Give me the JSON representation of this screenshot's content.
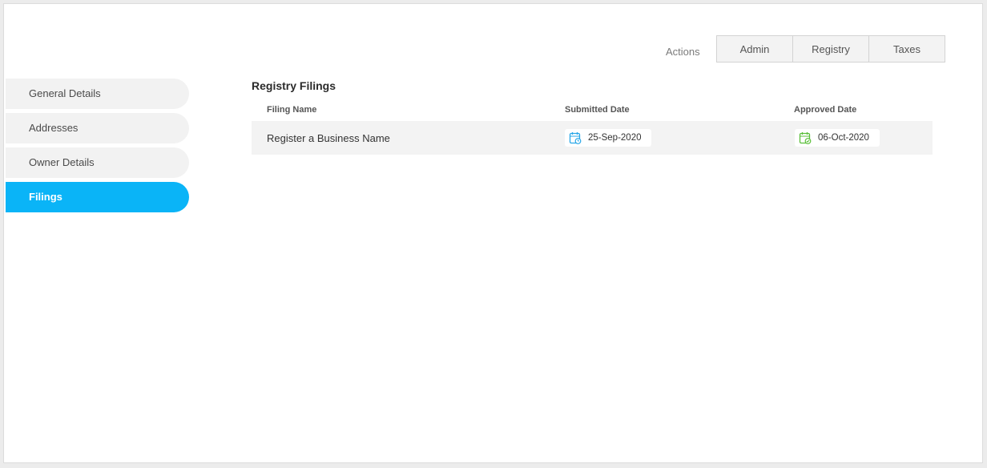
{
  "header": {
    "actions_label": "Actions",
    "tabs": [
      {
        "label": "Admin"
      },
      {
        "label": "Registry"
      },
      {
        "label": "Taxes"
      }
    ]
  },
  "sidebar": {
    "items": [
      {
        "label": "General Details",
        "active": false
      },
      {
        "label": "Addresses",
        "active": false
      },
      {
        "label": "Owner Details",
        "active": false
      },
      {
        "label": "Filings",
        "active": true
      }
    ]
  },
  "main": {
    "title": "Registry Filings",
    "columns": {
      "name": "Filing Name",
      "submitted": "Submitted Date",
      "approved": "Approved Date"
    },
    "rows": [
      {
        "name": "Register a Business Name",
        "submitted_date": "25-Sep-2020",
        "approved_date": "06-Oct-2020"
      }
    ]
  },
  "colors": {
    "accent": "#0ab4f7",
    "submitted_icon": "#2aa8e8",
    "approved_icon": "#5bbf3a"
  },
  "icons": {
    "submitted": "calendar-clock-icon",
    "approved": "calendar-check-icon"
  }
}
